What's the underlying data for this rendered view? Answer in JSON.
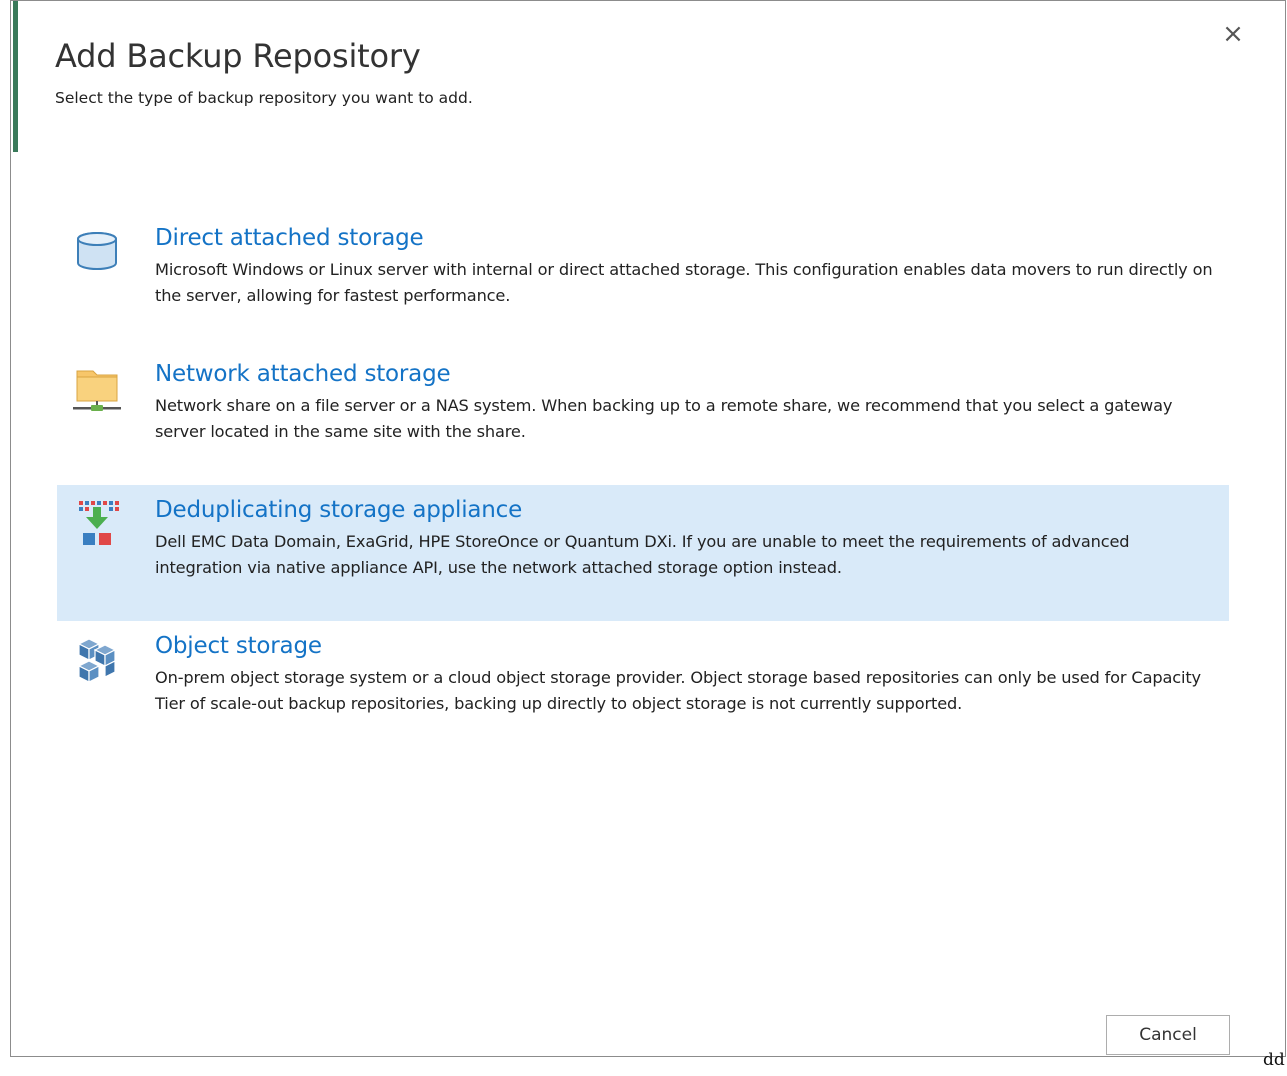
{
  "dialog": {
    "title": "Add Backup Repository",
    "subtitle": "Select the type of backup repository you want to add.",
    "close_icon": "×",
    "accent_color": "#3a7a5a"
  },
  "options": [
    {
      "icon": "database-icon",
      "title": "Direct attached storage",
      "description": "Microsoft Windows or Linux server with internal or direct attached storage. This configuration enables data movers to run directly on the server, allowing for fastest performance.",
      "selected": false
    },
    {
      "icon": "network-folder-icon",
      "title": "Network attached storage",
      "description": "Network share on a file server or a NAS system. When backing up to a remote share, we recommend that you select a gateway server located in the same site with the share.",
      "selected": false
    },
    {
      "icon": "dedup-appliance-icon",
      "title": "Deduplicating storage appliance",
      "description": "Dell EMC Data Domain, ExaGrid, HPE StoreOnce or Quantum DXi. If you are unable to meet the requirements of advanced integration via native appliance API, use the network attached storage option instead.",
      "selected": true
    },
    {
      "icon": "object-storage-icon",
      "title": "Object storage",
      "description": "On-prem object storage system or a cloud object storage provider. Object storage based repositories can only be used for Capacity Tier of scale-out backup repositories, backing up directly to object storage is not currently supported.",
      "selected": false
    }
  ],
  "footer": {
    "cancel_label": "Cancel"
  },
  "corner_text": "dd",
  "colors": {
    "link_blue": "#1473c6",
    "selected_bg": "#d9eaf9"
  }
}
